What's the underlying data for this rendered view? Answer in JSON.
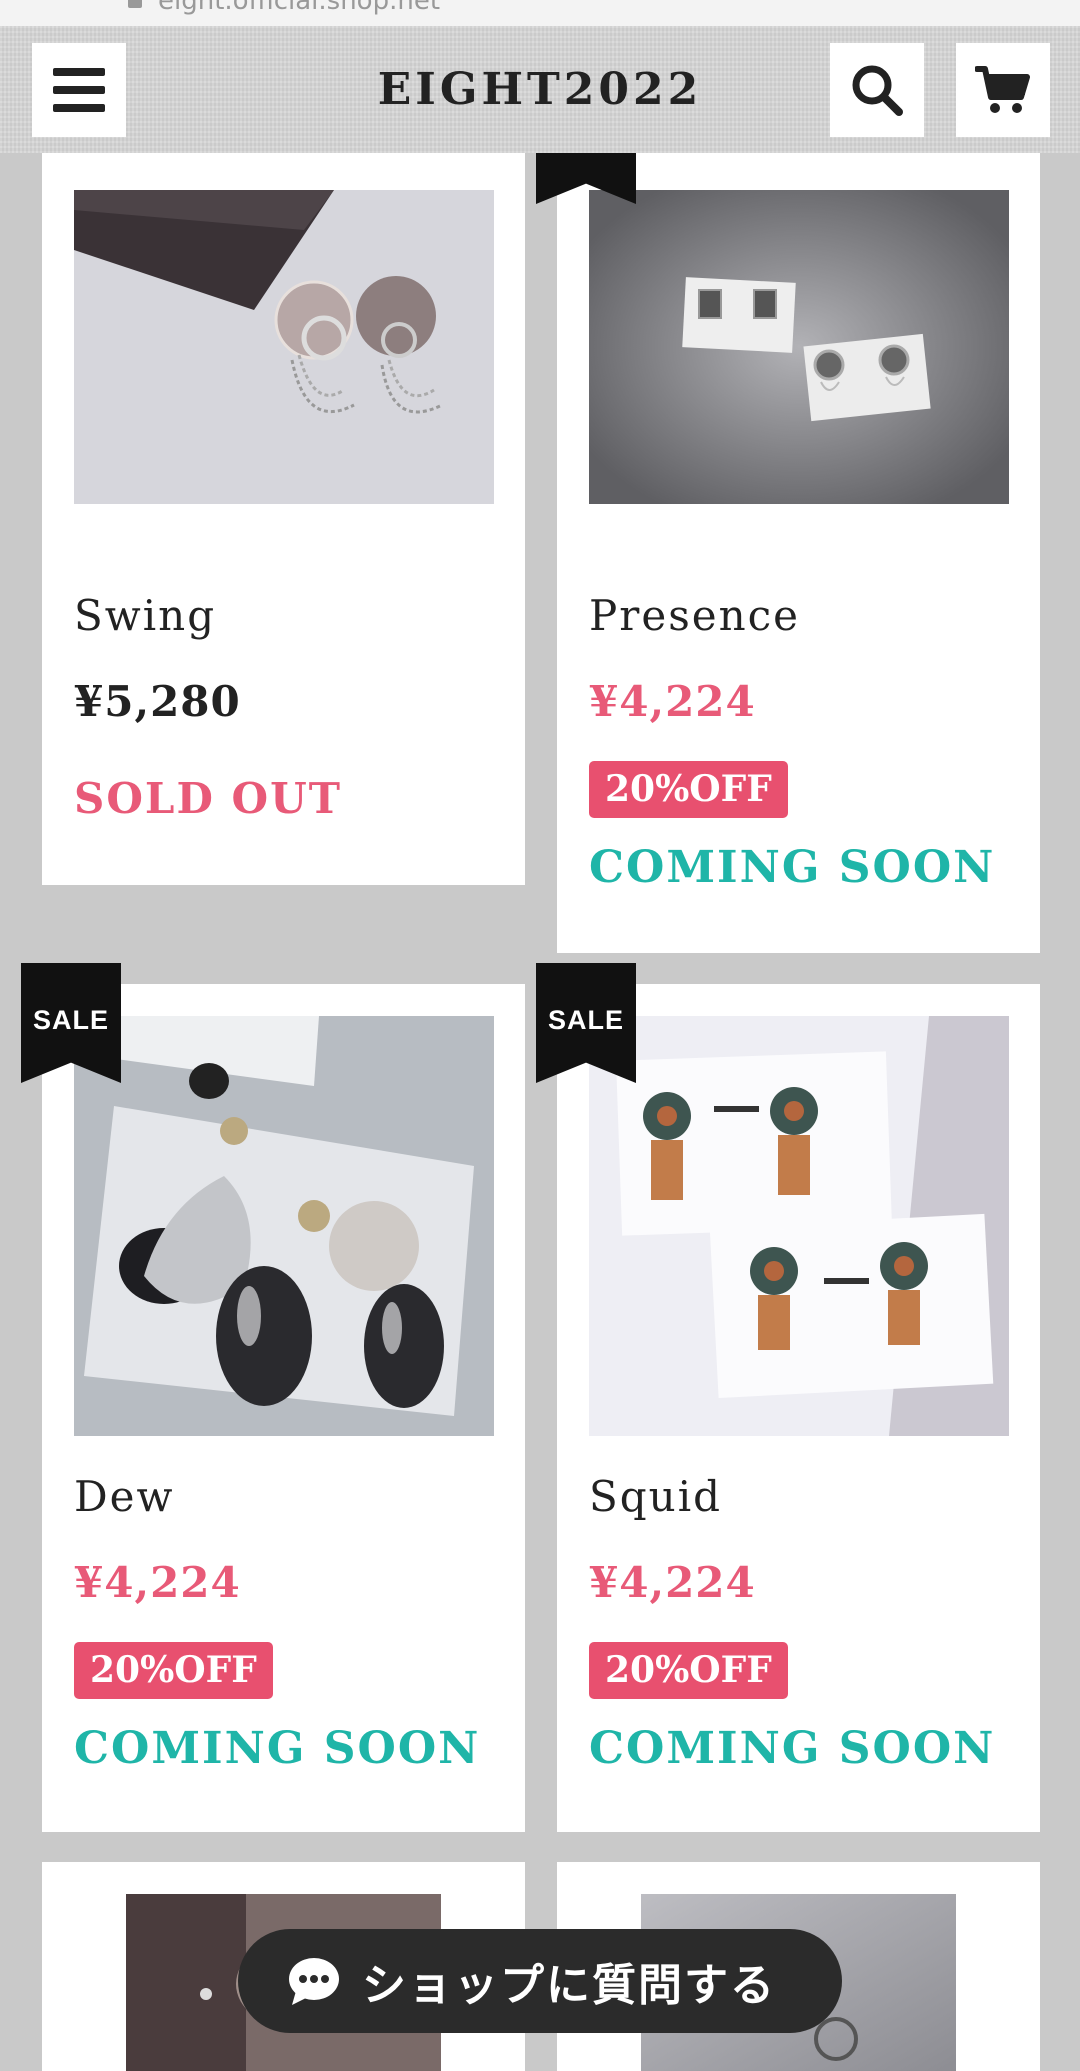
{
  "browser": {
    "url": "eight.official.shop.net"
  },
  "header": {
    "title": "EIGHT2022",
    "menu_icon": "hamburger-menu-icon",
    "search_icon": "search-icon",
    "cart_icon": "cart-icon"
  },
  "products": [
    {
      "name": "Swing",
      "price": "¥5,280",
      "status": "SOLD OUT"
    },
    {
      "name": "Presence",
      "price": "¥4,224",
      "discount": "20%OFF",
      "status": "COMING SOON"
    },
    {
      "name": "Dew",
      "price": "¥4,224",
      "discount": "20%OFF",
      "status": "COMING SOON",
      "badge": "SALE"
    },
    {
      "name": "Squid",
      "price": "¥4,224",
      "discount": "20%OFF",
      "status": "COMING SOON",
      "badge": "SALE"
    }
  ],
  "chat": {
    "label": "ショップに質問する",
    "icon": "chat-bubble-icon"
  },
  "colors": {
    "sale_price": "#e85a78",
    "discount_bg": "#e8506f",
    "coming_soon": "#1fb5a8",
    "ribbon": "#111111"
  }
}
